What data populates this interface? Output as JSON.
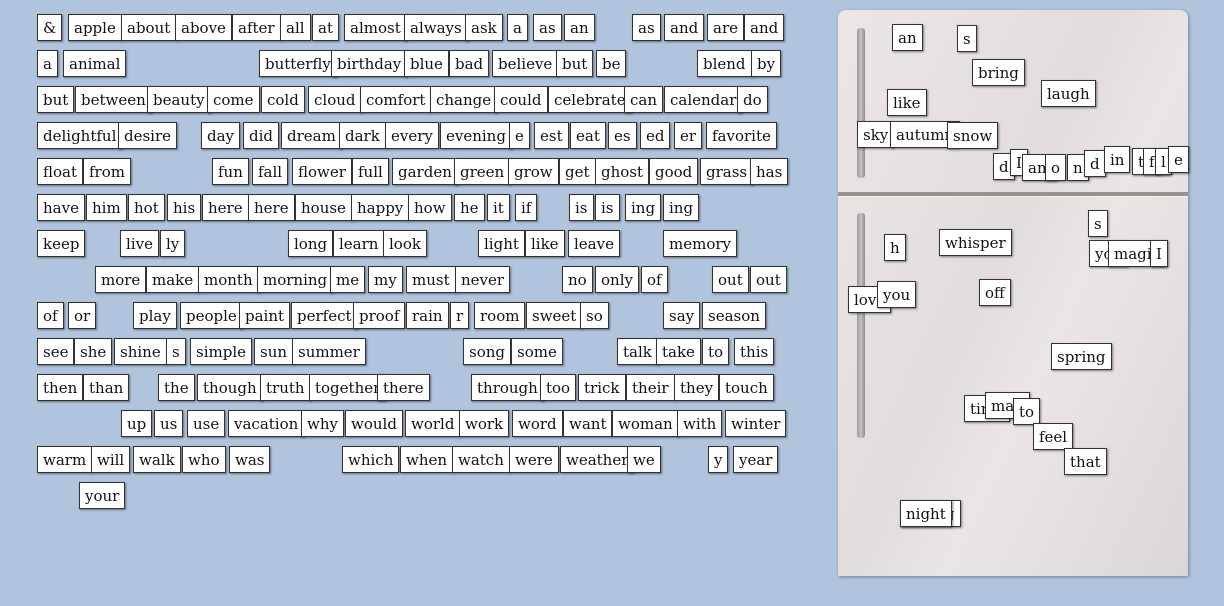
{
  "bank_words": [
    "&",
    "apple",
    "about",
    "above",
    "after",
    "all",
    "at",
    "almost",
    "always",
    "ask",
    "a",
    "as",
    "an",
    "as",
    "and",
    "are",
    "and",
    "a",
    "animal",
    "butterfly",
    "birthday",
    "blue",
    "bad",
    "believe",
    "but",
    "be",
    "blend",
    "by",
    "but",
    "between",
    "beauty",
    "come",
    "cold",
    "cloud",
    "comfort",
    "change",
    "could",
    "celebrate",
    "can",
    "calendar",
    "do",
    "delightful",
    "desire",
    "day",
    "did",
    "dream",
    "dark",
    "every",
    "evening",
    "e",
    "est",
    "eat",
    "es",
    "ed",
    "er",
    "favorite",
    "float",
    "from",
    "fun",
    "fall",
    "flower",
    "full",
    "garden",
    "green",
    "grow",
    "get",
    "ghost",
    "good",
    "grass",
    "has",
    "have",
    "him",
    "hot",
    "his",
    "here",
    "here",
    "house",
    "happy",
    "how",
    "he",
    "it",
    "if",
    "is",
    "is",
    "ing",
    "ing",
    "keep",
    "live",
    "ly",
    "long",
    "learn",
    "look",
    "light",
    "like",
    "leave",
    "memory",
    "more",
    "make",
    "month",
    "morning",
    "me",
    "my",
    "must",
    "never",
    "no",
    "only",
    "of",
    "out",
    "out",
    "of",
    "or",
    "play",
    "people",
    "paint",
    "perfect",
    "proof",
    "rain",
    "r",
    "room",
    "sweet",
    "so",
    "say",
    "season",
    "see",
    "she",
    "shine",
    "s",
    "simple",
    "sun",
    "summer",
    "song",
    "some",
    "talk",
    "take",
    "to",
    "this",
    "then",
    "than",
    "the",
    "though",
    "truth",
    "together",
    "there",
    "through",
    "too",
    "trick",
    "their",
    "they",
    "touch",
    "up",
    "us",
    "use",
    "vacation",
    "why",
    "would",
    "world",
    "work",
    "word",
    "want",
    "woman",
    "with",
    "winter",
    "warm",
    "will",
    "walk",
    "who",
    "was",
    "which",
    "when",
    "watch",
    "were",
    "weather",
    "we",
    "y",
    "year",
    "your"
  ],
  "fridge_words": [
    "an",
    "s",
    "bring",
    "laugh",
    "like",
    "sky",
    "autumn",
    "snow",
    "d",
    "I",
    "am",
    "o",
    "n",
    "d",
    "in",
    "the",
    "f",
    "l",
    "e",
    "s",
    "h",
    "whisper",
    "you",
    "magic",
    "I",
    "love",
    "you",
    "off",
    "spring",
    "time",
    "man",
    "to",
    "feel",
    "that",
    "spring",
    "night"
  ]
}
